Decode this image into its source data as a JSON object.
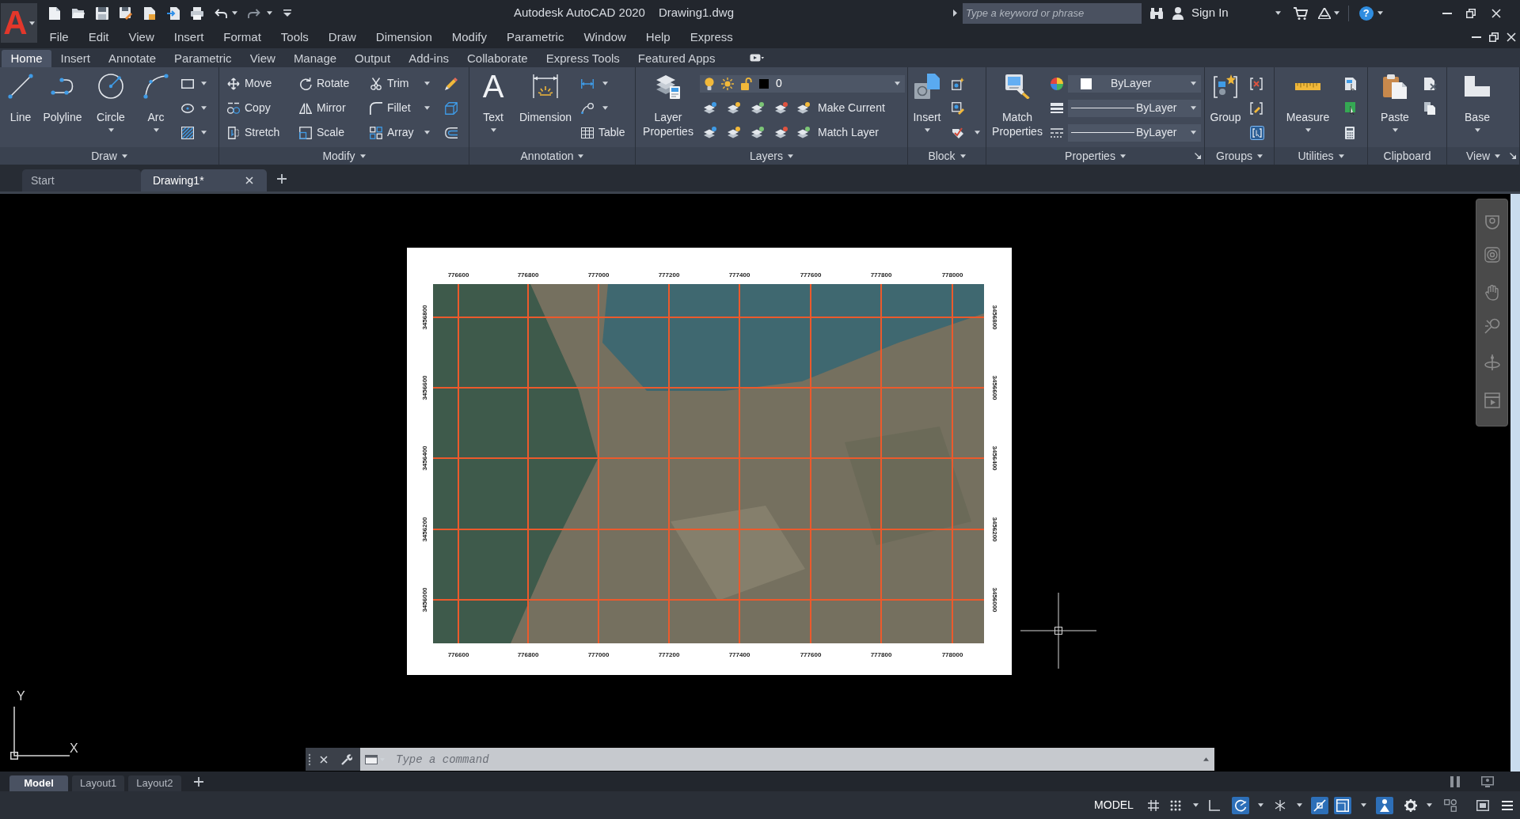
{
  "app_button": {
    "glyph": "A"
  },
  "title_bar": {
    "app_name": "Autodesk AutoCAD 2020",
    "document": "Drawing1.dwg",
    "search": {
      "placeholder": "Type a keyword or phrase"
    },
    "sign_in": "Sign In",
    "help": "?"
  },
  "menu_bar": [
    "File",
    "Edit",
    "View",
    "Insert",
    "Format",
    "Tools",
    "Draw",
    "Dimension",
    "Modify",
    "Parametric",
    "Window",
    "Help",
    "Express"
  ],
  "ribbon_tabs": [
    {
      "label": "Home",
      "selected": true
    },
    {
      "label": "Insert",
      "selected": false
    },
    {
      "label": "Annotate",
      "selected": false
    },
    {
      "label": "Parametric",
      "selected": false
    },
    {
      "label": "View",
      "selected": false
    },
    {
      "label": "Manage",
      "selected": false
    },
    {
      "label": "Output",
      "selected": false
    },
    {
      "label": "Add-ins",
      "selected": false
    },
    {
      "label": "Collaborate",
      "selected": false
    },
    {
      "label": "Express Tools",
      "selected": false
    },
    {
      "label": "Featured Apps",
      "selected": false
    }
  ],
  "ribbon_panels": [
    {
      "title": "Draw",
      "tools": [
        {
          "label": "Line"
        },
        {
          "label": "Polyline"
        },
        {
          "label": "Circle"
        },
        {
          "label": "Arc"
        }
      ]
    },
    {
      "title": "Modify",
      "tools": [
        {
          "label": "Move"
        },
        {
          "label": "Copy"
        },
        {
          "label": "Stretch"
        },
        {
          "label": "Rotate"
        },
        {
          "label": "Mirror"
        },
        {
          "label": "Scale"
        },
        {
          "label": "Trim"
        },
        {
          "label": "Fillet"
        },
        {
          "label": "Array"
        }
      ]
    },
    {
      "title": "Annotation",
      "tools": [
        {
          "label": "Text",
          "glyph": "A"
        },
        {
          "label": "Dimension"
        },
        {
          "label": "Table"
        }
      ]
    },
    {
      "title": "Layers",
      "tools": [
        {
          "label": "Layer Properties"
        },
        {
          "label": "Make Current"
        },
        {
          "label": "Match Layer"
        }
      ],
      "layer": "0"
    },
    {
      "title": "Block",
      "tools": [
        {
          "label": "Insert"
        }
      ]
    },
    {
      "title": "Properties",
      "tools": [
        {
          "label": "Match Properties"
        }
      ],
      "combos": [
        "ByLayer",
        "ByLayer",
        "ByLayer"
      ]
    },
    {
      "title": "Groups",
      "tools": [
        {
          "label": "Group"
        }
      ]
    },
    {
      "title": "Utilities",
      "tools": [
        {
          "label": "Measure"
        }
      ]
    },
    {
      "title": "Clipboard",
      "tools": [
        {
          "label": "Paste"
        }
      ]
    },
    {
      "title": "View",
      "tools": [
        {
          "label": "Base"
        }
      ]
    }
  ],
  "file_tabs": [
    {
      "label": "Start",
      "selected": false
    },
    {
      "label": "Drawing1*",
      "selected": true
    }
  ],
  "map_sheet": {
    "top_labels": [
      "776600",
      "776800",
      "777000",
      "777200",
      "777400",
      "777600",
      "777800",
      "778000"
    ],
    "left_labels": [
      "3456800",
      "3456600",
      "3456400",
      "3456200",
      "3456000"
    ],
    "right_labels": [
      "3456800",
      "3456600",
      "3456400",
      "3456200",
      "3456000"
    ],
    "bottom_labels": [
      "776600",
      "776800",
      "777000",
      "777200",
      "777400",
      "777600",
      "777800",
      "778000"
    ]
  },
  "ucs_icon": {
    "y_label": "Y",
    "x_label": "X"
  },
  "command_line": {
    "placeholder": "Type a command"
  },
  "layout_tabs": [
    {
      "label": "Model",
      "selected": true
    },
    {
      "label": "Layout1",
      "selected": false
    },
    {
      "label": "Layout2",
      "selected": false
    }
  ],
  "status_bar": {
    "space": "MODEL",
    "toggles": [
      {
        "on": false
      },
      {
        "on": false
      },
      {
        "on": false
      },
      {
        "on": true
      },
      {
        "on": false
      },
      {
        "on": true
      },
      {
        "on": true
      },
      {
        "on": true
      }
    ]
  }
}
